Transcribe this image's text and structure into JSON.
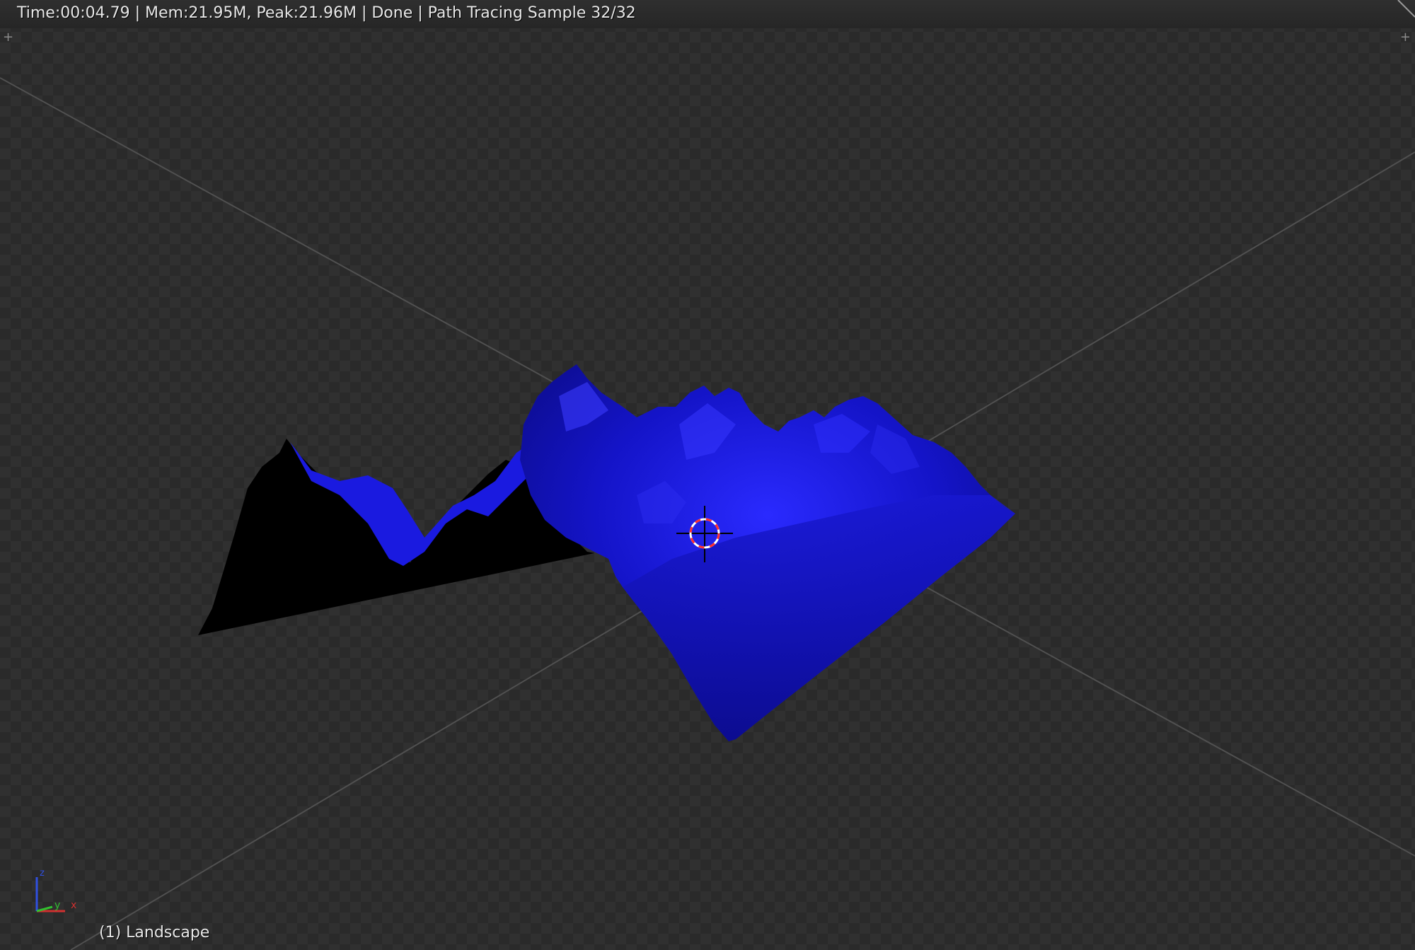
{
  "viewport": {
    "status_text": "Time:00:04.79 | Mem:21.95M, Peak:21.96M | Done | Path Tracing Sample 32/32",
    "object_label": "(1) Landscape",
    "axis_labels": {
      "x": "x",
      "y": "y",
      "z": "z"
    }
  },
  "colors": {
    "background": "#303030",
    "grid_line": "#4a4a4a",
    "landscape_blue": "#1010c8",
    "landscape_shadow": "#000000",
    "cursor_red": "#ff3030",
    "axis_x": "#d03030",
    "axis_y": "#30c030",
    "axis_z": "#3050e0"
  },
  "icons": {
    "region_plus_left": "plus-icon",
    "region_plus_right": "plus-icon",
    "cursor": "3d-cursor-icon"
  }
}
